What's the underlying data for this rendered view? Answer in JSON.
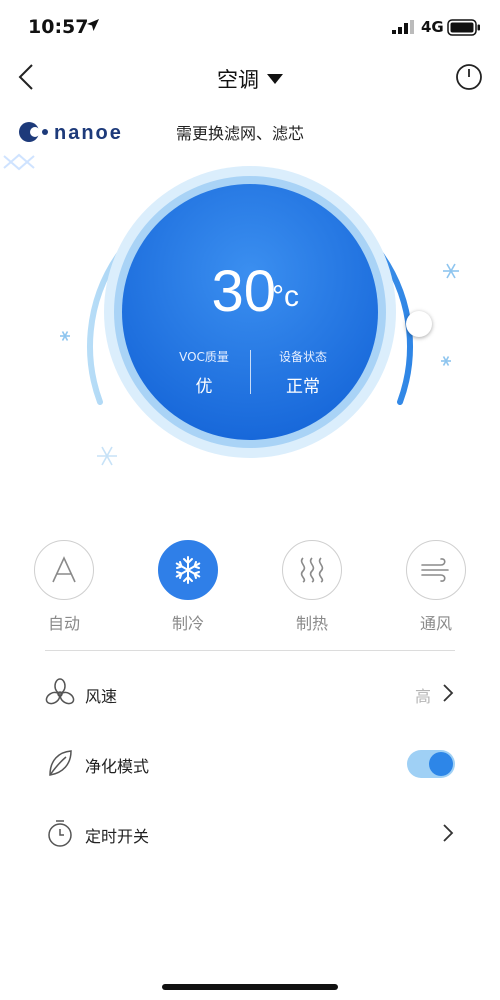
{
  "status_bar": {
    "time": "10:57",
    "network": "4G"
  },
  "nav": {
    "title": "空调"
  },
  "banner": {
    "brand": "nanoe",
    "notice": "需更换滤网、滤芯"
  },
  "dial": {
    "temperature": "30",
    "unit": "°c",
    "voc_label": "VOC质量",
    "voc_value": "优",
    "device_label": "设备状态",
    "device_value": "正常"
  },
  "modes": [
    {
      "label": "自动",
      "icon": "letter-a-icon",
      "active": false
    },
    {
      "label": "制冷",
      "icon": "snowflake-icon",
      "active": true
    },
    {
      "label": "制热",
      "icon": "heat-waves-icon",
      "active": false
    },
    {
      "label": "通风",
      "icon": "wind-icon",
      "active": false
    }
  ],
  "settings": {
    "fan_speed": {
      "label": "风速",
      "value": "高"
    },
    "purify": {
      "label": "净化模式",
      "on": true
    },
    "timer": {
      "label": "定时开关"
    }
  },
  "colors": {
    "accent": "#2f7fe8",
    "toggle_track": "#9fd0f5",
    "snow": "#8ec5ef"
  }
}
